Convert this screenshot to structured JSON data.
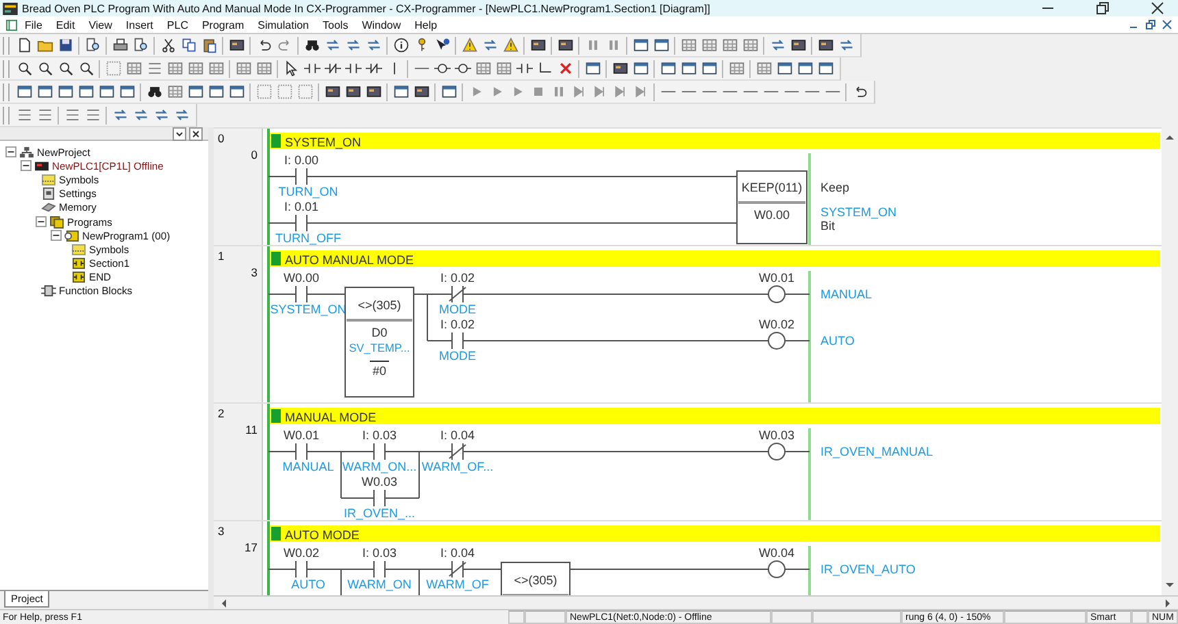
{
  "window": {
    "title": "Bread Oven PLC Program With Auto And Manual Mode In CX-Programmer - CX-Programmer - [NewPLC1.NewProgram1.Section1 [Diagram]]"
  },
  "menu": [
    "File",
    "Edit",
    "View",
    "Insert",
    "PLC",
    "Program",
    "Simulation",
    "Tools",
    "Window",
    "Help"
  ],
  "project_tree": {
    "items": [
      {
        "label": "NewProject",
        "kind": "project",
        "expanded": true,
        "children": [
          {
            "label": "NewPLC1[CP1L] Offline",
            "kind": "plc",
            "expanded": true,
            "children": [
              {
                "label": "Symbols",
                "kind": "symbols"
              },
              {
                "label": "Settings",
                "kind": "settings"
              },
              {
                "label": "Memory",
                "kind": "memory"
              },
              {
                "label": "Programs",
                "kind": "programs",
                "expanded": true,
                "children": [
                  {
                    "label": "NewProgram1 (00)",
                    "kind": "program",
                    "expanded": true,
                    "children": [
                      {
                        "label": "Symbols",
                        "kind": "symbols"
                      },
                      {
                        "label": "Section1",
                        "kind": "section"
                      },
                      {
                        "label": "END",
                        "kind": "section"
                      }
                    ]
                  }
                ]
              },
              {
                "label": "Function Blocks",
                "kind": "function_blocks"
              }
            ]
          }
        ]
      }
    ],
    "tab": "Project"
  },
  "ladder": {
    "rungs": [
      {
        "number": "0",
        "step": "0",
        "comment": "SYSTEM_ON",
        "elements": [
          {
            "kind": "contact_no",
            "address": "I: 0.00",
            "symbol": "TURN_ON"
          },
          {
            "kind": "contact_no",
            "address": "I: 0.01",
            "symbol": "TURN_OFF"
          },
          {
            "kind": "keep",
            "instruction": "KEEP(011)",
            "comment": "Keep",
            "operand": "W0.00",
            "operand_symbol": "SYSTEM_ON",
            "operand_comment": "Bit"
          }
        ]
      },
      {
        "number": "1",
        "step": "3",
        "comment": "AUTO MANUAL MODE",
        "elements": [
          {
            "kind": "contact_no",
            "address": "W0.00",
            "symbol": "SYSTEM_ON"
          },
          {
            "kind": "compare",
            "instruction": "<>(305)",
            "operands": [
              {
                "value": "D0",
                "symbol": "SV_TEMP..."
              },
              {
                "value": "#0"
              }
            ]
          },
          {
            "kind": "contact_nc",
            "address": "I: 0.02",
            "symbol": "MODE"
          },
          {
            "kind": "coil",
            "address": "W0.01",
            "symbol": "MANUAL"
          },
          {
            "kind": "contact_no",
            "address": "I: 0.02",
            "symbol": "MODE"
          },
          {
            "kind": "coil",
            "address": "W0.02",
            "symbol": "AUTO"
          }
        ]
      },
      {
        "number": "2",
        "step": "11",
        "comment": "MANUAL MODE",
        "elements": [
          {
            "kind": "contact_no",
            "address": "W0.01",
            "symbol": "MANUAL"
          },
          {
            "kind": "contact_no",
            "address": "I: 0.03",
            "symbol": "WARM_ON..."
          },
          {
            "kind": "contact_nc",
            "address": "I: 0.04",
            "symbol": "WARM_OF..."
          },
          {
            "kind": "coil",
            "address": "W0.03",
            "symbol": "IR_OVEN_MANUAL"
          },
          {
            "kind": "contact_no",
            "address": "W0.03",
            "symbol": "IR_OVEN_..."
          }
        ]
      },
      {
        "number": "3",
        "step": "17",
        "comment": "AUTO MODE",
        "elements": [
          {
            "kind": "contact_no",
            "address": "W0.02",
            "symbol": "AUTO"
          },
          {
            "kind": "contact_no",
            "address": "I: 0.03",
            "symbol": "WARM_ON"
          },
          {
            "kind": "contact_nc",
            "address": "I: 0.04",
            "symbol": "WARM_OF"
          },
          {
            "kind": "compare",
            "instruction": "<>(305)"
          },
          {
            "kind": "coil",
            "address": "W0.04",
            "symbol": "IR_OVEN_AUTO"
          }
        ]
      }
    ]
  },
  "status_bar": {
    "help_text": "For Help, press F1",
    "connection": "NewPLC1(Net:0,Node:0) - Offline",
    "position": "rung 6 (4, 0)  - 150%",
    "mode": "Smart",
    "keyboard": "NUM"
  }
}
